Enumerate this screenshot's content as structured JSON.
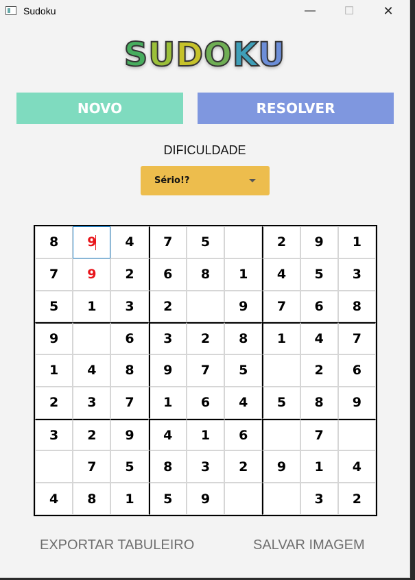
{
  "window": {
    "title": "Sudoku",
    "min_icon": "minimize-icon",
    "max_icon": "maximize-icon",
    "close_icon": "close-icon",
    "min_glyph": "—",
    "max_glyph": "☐",
    "close_glyph": "✕"
  },
  "logo": {
    "letters": [
      "S",
      "U",
      "D",
      "O",
      "K",
      "U"
    ],
    "colors": [
      "#47ad5e",
      "#9bc03a",
      "#c6c22a",
      "#6fae54",
      "#3f9fb8",
      "#6c8ed8"
    ]
  },
  "buttons": {
    "novo": "NOVO",
    "novo_color": "#7fdbbf",
    "resolver": "RESOLVER",
    "resolver_color": "#7f97df"
  },
  "difficulty": {
    "label": "DIFICULDADE",
    "selected": "Sério!?",
    "color": "#edbd4d"
  },
  "board": {
    "rows": [
      [
        "8",
        "9",
        "4",
        "7",
        "5",
        "",
        "2",
        "9",
        "1"
      ],
      [
        "7",
        "9",
        "2",
        "6",
        "8",
        "1",
        "4",
        "5",
        "3"
      ],
      [
        "5",
        "1",
        "3",
        "2",
        "",
        "9",
        "7",
        "6",
        "8"
      ],
      [
        "9",
        "",
        "6",
        "3",
        "2",
        "8",
        "1",
        "4",
        "7"
      ],
      [
        "1",
        "4",
        "8",
        "9",
        "7",
        "5",
        "",
        "2",
        "6"
      ],
      [
        "2",
        "3",
        "7",
        "1",
        "6",
        "4",
        "5",
        "8",
        "9"
      ],
      [
        "3",
        "2",
        "9",
        "4",
        "1",
        "6",
        "",
        "7",
        ""
      ],
      [
        "",
        "7",
        "5",
        "8",
        "3",
        "2",
        "9",
        "1",
        "4"
      ],
      [
        "4",
        "8",
        "1",
        "5",
        "9",
        "",
        "",
        "3",
        "2"
      ]
    ],
    "conflict_cells": [
      [
        0,
        1
      ],
      [
        1,
        1
      ]
    ],
    "selected_cell": [
      0,
      1
    ],
    "conflict_color": "#e8141a"
  },
  "footer": {
    "export": "EXPORTAR TABULEIRO",
    "save_image": "SALVAR IMAGEM"
  }
}
